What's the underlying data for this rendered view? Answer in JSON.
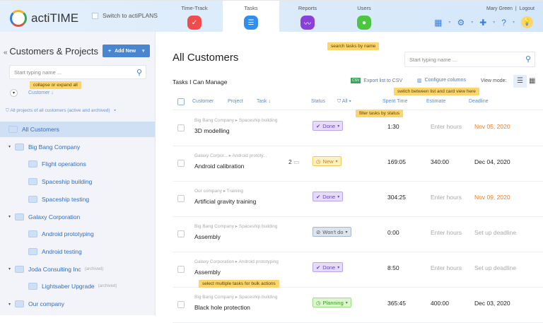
{
  "header": {
    "logo": "actiTIME",
    "switch": "Switch to actiPLANS",
    "user": "Mary Green",
    "logout": "Logout",
    "tabs": [
      {
        "label": "Time-Track",
        "color": "#ef4d4d"
      },
      {
        "label": "Tasks",
        "color": "#2f8ef0"
      },
      {
        "label": "Reports",
        "color": "#8a3fd6"
      },
      {
        "label": "Users",
        "color": "#4cc640"
      }
    ],
    "icons": [
      "calendar-icon",
      "gear-icon",
      "puzzle-icon",
      "help-icon",
      "lightbulb-icon"
    ]
  },
  "sidebar": {
    "title": "Customers & Projects",
    "add_new": "Add New",
    "search_placeholder": "Start typing name ...",
    "tip_collapse": "collapse or expand all",
    "sort_label": "Customer",
    "filter": "All projects of all customers (active and archived)",
    "items": [
      {
        "label": "All Customers",
        "level": 0,
        "selected": true
      },
      {
        "label": "Big Bang Company",
        "level": 1
      },
      {
        "label": "Flight operations",
        "level": 2
      },
      {
        "label": "Spaceship building",
        "level": 2
      },
      {
        "label": "Spaceship testing",
        "level": 2
      },
      {
        "label": "Galaxy Corporation",
        "level": 1
      },
      {
        "label": "Android prototyping",
        "level": 2
      },
      {
        "label": "Android testing",
        "level": 2
      },
      {
        "label": "Joda Consulting Inc",
        "level": 1,
        "archived": "(archived)"
      },
      {
        "label": "Lightsaber Upgrade",
        "level": 2,
        "archived": "(archived)"
      },
      {
        "label": "Our company",
        "level": 1
      }
    ]
  },
  "main": {
    "title": "All Customers",
    "search_placeholder": "Start typing name ...",
    "tip_search": "search tasks by name",
    "subtitle": "Tasks I Can Manage",
    "export": "Export list to CSV",
    "configure": "Configure columns",
    "view_mode": "View mode:",
    "tip_view": "switch between list and card view here",
    "tip_filter": "filter tasks by status",
    "tip_bulk": "select multiple tasks for bulk actions",
    "columns": {
      "customer": "Customer",
      "project": "Project",
      "task": "Task",
      "status": "Status",
      "filter": "All",
      "spent": "Spent Time",
      "estimate": "Estimate",
      "deadline": "Deadline"
    },
    "rows": [
      {
        "path": "Big Bang Company ▸ Spaceship building",
        "name": "3D modelling",
        "status": "Done",
        "spent": "1:30",
        "estimate": "Enter hours",
        "deadline": "Nov 05, 2020",
        "overdue": true
      },
      {
        "path": "Galaxy Corpor...  ▸ Android prototy...",
        "name": "Android calibration",
        "comments": "2",
        "status": "New",
        "spent": "169:05",
        "estimate": "340:00",
        "deadline": "Dec 04, 2020"
      },
      {
        "path": "Our company ▸ Training",
        "name": "Artificial gravity training",
        "status": "Done",
        "spent": "304:25",
        "estimate": "Enter hours",
        "deadline": "Nov 09, 2020",
        "overdue": true
      },
      {
        "path": "Big Bang Company ▸ Spaceship building",
        "name": "Assembly",
        "status": "Won't do",
        "spent": "0:00",
        "estimate": "Enter hours",
        "deadline": "Set up deadline"
      },
      {
        "path": "Galaxy Corporation ▸ Android prototyping",
        "name": "Assembly",
        "status": "Done",
        "spent": "8:50",
        "estimate": "Enter hours",
        "deadline": "Set up deadline"
      },
      {
        "path": "Big Bang Company ▸ Spaceship building",
        "name": "Black hole protection",
        "status": "Planning",
        "spent": "365:45",
        "estimate": "400:00",
        "deadline": "Dec 03, 2020"
      }
    ]
  }
}
